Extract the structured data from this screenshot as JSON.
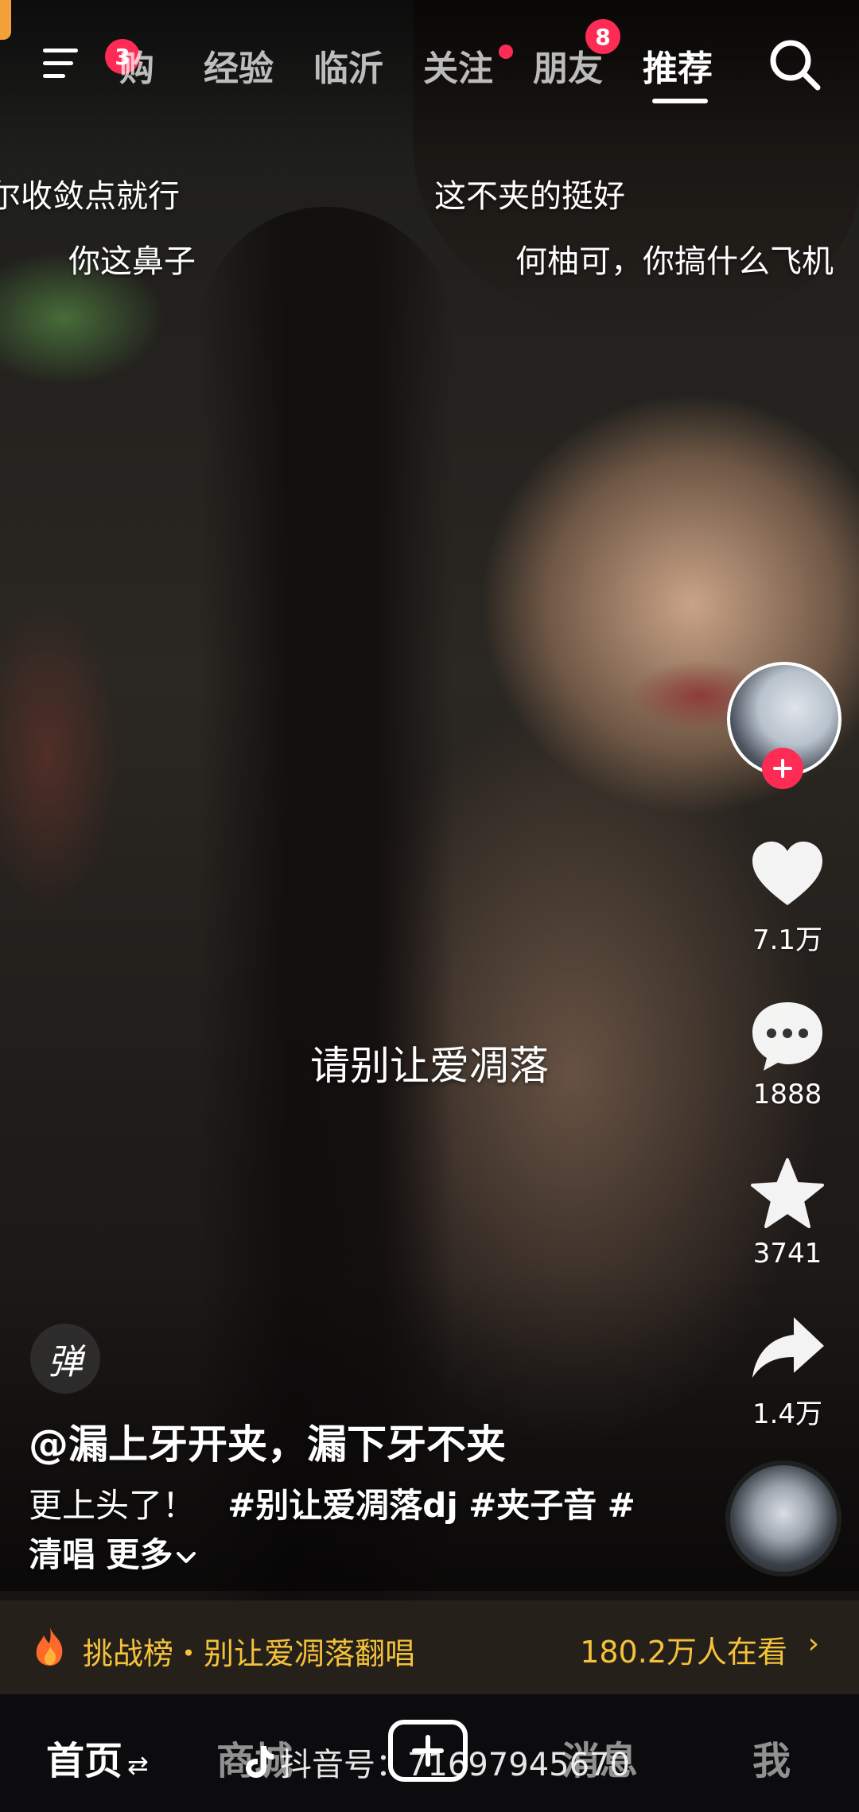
{
  "top_nav": {
    "menu_badge": "3",
    "tabs": [
      {
        "label": "购",
        "badge": null
      },
      {
        "label": "经验",
        "badge": null
      },
      {
        "label": "临沂",
        "badge": null
      },
      {
        "label": "关注",
        "badge": "dot"
      },
      {
        "label": "朋友",
        "badge": "8"
      },
      {
        "label": "推荐",
        "badge": null
      }
    ],
    "active_tab": "推荐"
  },
  "danmaku": [
    "尔收敛点就行",
    "这不夹的挺好",
    "你这鼻子",
    "何柚可，你搞什么飞机"
  ],
  "lyric": "请别让爱凋落",
  "rail": {
    "likes": "7.1万",
    "comments": "1888",
    "favorites": "3741",
    "shares": "1.4万"
  },
  "caption": {
    "danmu_toggle": "弹",
    "author": "@漏上牙开夹，漏下牙不夹",
    "text": "更上头了！",
    "tags": [
      "#别让爱凋落dj",
      "#夹子音",
      "#清唱"
    ],
    "more": "更多"
  },
  "challenge": {
    "title": "挑战榜・别让爱凋落翻唱",
    "viewers": "180.2万人在看"
  },
  "tabbar": {
    "home": "首页",
    "mall": "商城",
    "messages": "消息",
    "me": "我"
  },
  "watermark": "抖音号：71697945670",
  "colors": {
    "accent_red": "#fe2c55",
    "challenge_gold": "#f4c23a"
  }
}
